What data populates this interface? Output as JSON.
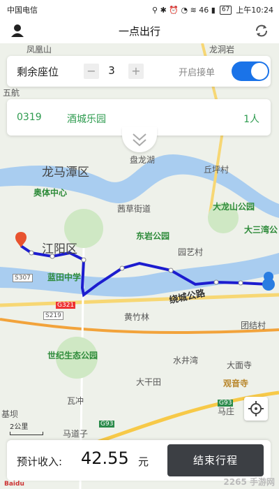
{
  "status": {
    "carrier": "中国电信",
    "icons": "⚲ ✱ ⏰ ◔ ≋ 46 ▮",
    "battery": "67",
    "time": "上午10:24"
  },
  "nav": {
    "title": "一点出行",
    "user_icon": "user-icon",
    "refresh_icon": "refresh-icon"
  },
  "seats": {
    "label": "剩余座位",
    "minus": "−",
    "value": "3",
    "plus": "+",
    "accept_label": "开启接单",
    "accept_on": true
  },
  "order": {
    "id": "0319",
    "place": "酒城乐园",
    "count": "1人"
  },
  "map_labels": {
    "poi1": "凤凰山",
    "poi2": "龙洞岩",
    "poi3": "五航",
    "poi4": "龙马潭区",
    "poi5": "奥体中心",
    "poi6": "江阳区",
    "poi7": "蓝田中学",
    "poi8": "茜草街道",
    "poi9": "东岩公园",
    "poi10": "大龙山公园",
    "poi11": "大三湾公",
    "poi12": "园艺村",
    "poi13": "绕城公路",
    "poi14": "黄竹林",
    "poi15": "团结村",
    "poi16": "世纪生态公园",
    "poi17": "水井湾",
    "poi18": "大面寺",
    "poi19": "大干田",
    "poi20": "观音寺",
    "poi21": "瓦冲",
    "poi22": "基坝",
    "poi23": "马道子",
    "poi24": "马庄",
    "poi25": "丘坪村",
    "poi26": "盘龙湖",
    "road1": "S307",
    "road2": "G321",
    "road3": "G93",
    "road4": "S219",
    "road5": "G93"
  },
  "scale": "2公里",
  "income": {
    "label": "预计收入:",
    "value": "42.55",
    "unit": "元"
  },
  "end_button": "结束行程",
  "watermark": "2265 手游网",
  "baidu": "Baidu"
}
